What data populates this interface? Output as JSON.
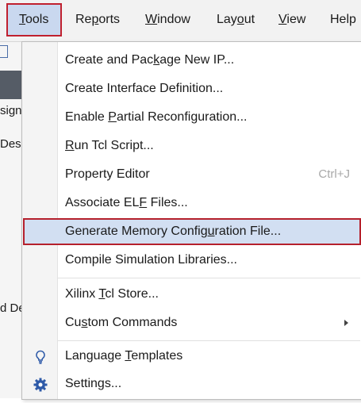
{
  "menubar": {
    "items": [
      {
        "label": "Tools",
        "mnemonic": "T",
        "rest": "ools"
      },
      {
        "label": "Reports",
        "mnemonic": "p",
        "pre": "Re",
        "rest": "orts"
      },
      {
        "label": "Window",
        "mnemonic": "W",
        "rest": "indow"
      },
      {
        "label": "Layout",
        "mnemonic": "o",
        "pre": "Lay",
        "rest": "ut"
      },
      {
        "label": "View",
        "mnemonic": "V",
        "rest": "iew"
      },
      {
        "label": "Help",
        "mnemonic": "",
        "rest": "Help"
      }
    ]
  },
  "background": {
    "fragment_1": "sign",
    "fragment_2": "Des",
    "fragment_3": "d De"
  },
  "tools_menu": {
    "items": [
      {
        "pre": "Create and Pac",
        "u": "k",
        "post": "age New IP..."
      },
      {
        "pre": "Create Interface Definition...",
        "u": "",
        "post": ""
      },
      {
        "pre": "Enable ",
        "u": "P",
        "post": "artial Reconfiguration..."
      },
      {
        "pre": "",
        "u": "R",
        "post": "un Tcl Script..."
      },
      {
        "pre": "Property Editor",
        "u": "",
        "post": "",
        "shortcut": "Ctrl+J"
      },
      {
        "pre": "Associate EL",
        "u": "F",
        "post": " Files..."
      },
      {
        "pre": "Generate Memory Config",
        "u": "u",
        "post": "ration File..."
      },
      {
        "pre": "Compile Simulation Libraries...",
        "u": "",
        "post": ""
      },
      {
        "pre": "Xilinx ",
        "u": "T",
        "post": "cl Store..."
      },
      {
        "pre": "Cu",
        "u": "s",
        "post": "tom Commands"
      },
      {
        "pre": "Language ",
        "u": "T",
        "post": "emplates"
      },
      {
        "pre": "Settings...",
        "u": "",
        "post": ""
      }
    ]
  },
  "colors": {
    "highlight_outline": "#b5202c",
    "highlight_fill": "#d2dff2",
    "icon_blue": "#2e5aa8"
  }
}
